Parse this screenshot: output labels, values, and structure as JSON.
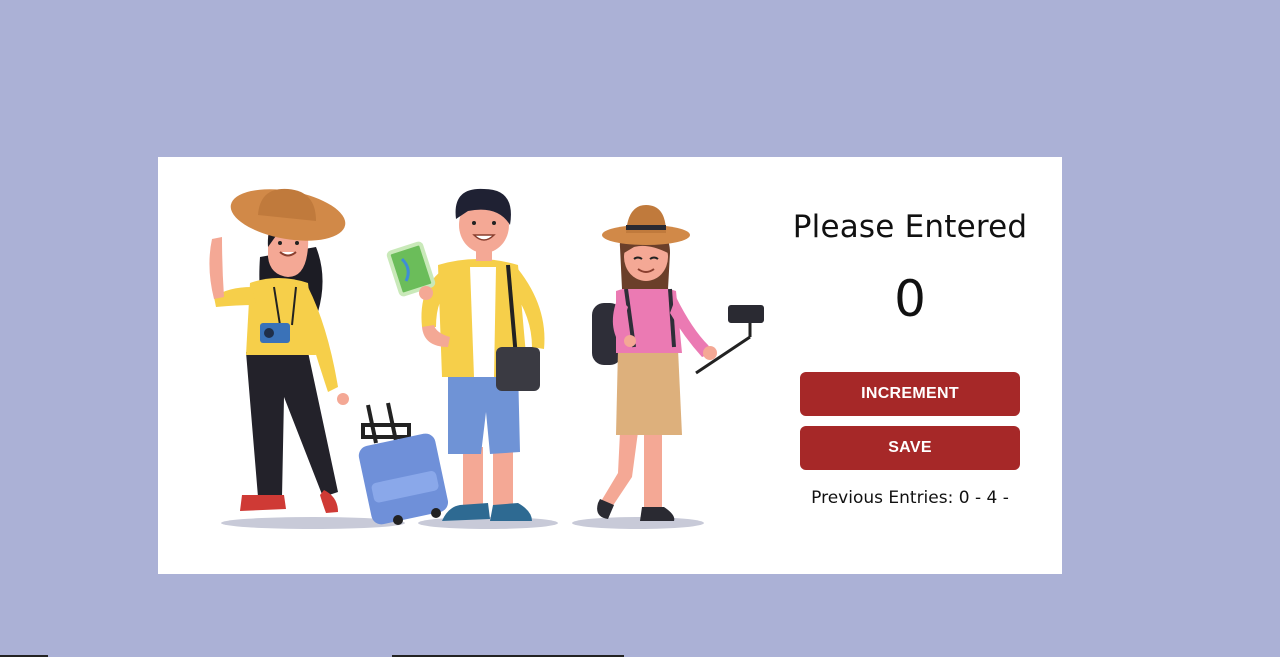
{
  "counter": {
    "title": "Please Entered",
    "count": "0",
    "increment_label": "INCREMENT",
    "save_label": "SAVE",
    "previous_entries": "Previous Entries: 0 - 4 -"
  },
  "illustration": {
    "subject": "travelers-illustration"
  },
  "colors": {
    "background": "#abb1d6",
    "card": "#ffffff",
    "button": "#a62828",
    "button_text": "#ffffff"
  }
}
